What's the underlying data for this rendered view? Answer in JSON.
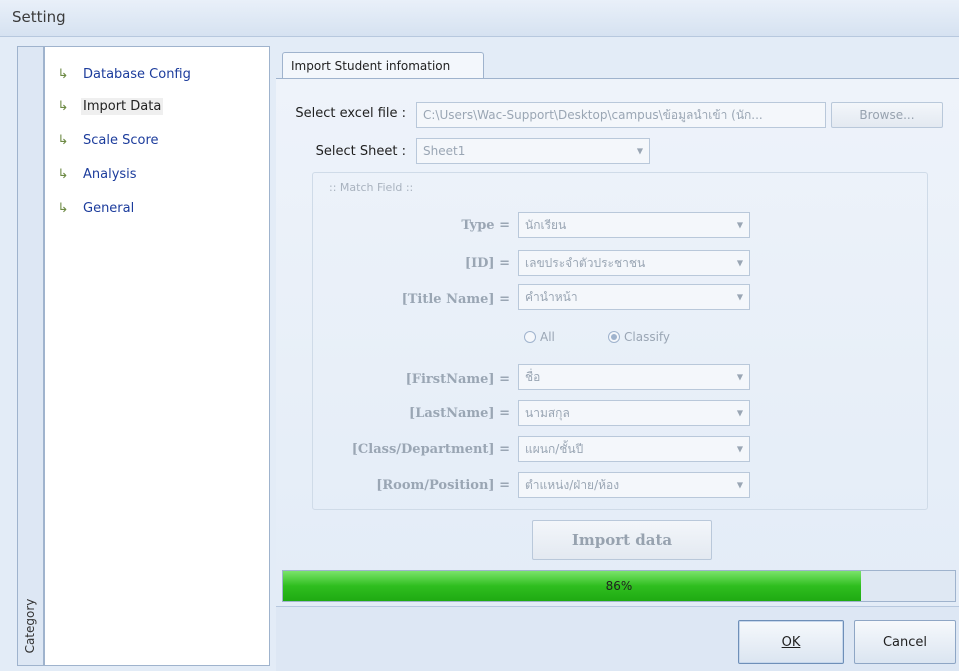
{
  "window": {
    "title": "Setting"
  },
  "category": {
    "label": "Category",
    "items": [
      {
        "label": "Database Config",
        "icon": "tree-arrow-icon",
        "active": false
      },
      {
        "label": "Import Data",
        "icon": "tree-arrow-icon",
        "active": true
      },
      {
        "label": "Scale Score",
        "icon": "tree-arrow-icon",
        "active": false
      },
      {
        "label": "Analysis",
        "icon": "tree-arrow-icon",
        "active": false
      },
      {
        "label": "General",
        "icon": "tree-arrow-icon",
        "active": false
      }
    ]
  },
  "tab": {
    "label": "Import Student infomation"
  },
  "excel": {
    "label": "Select excel file :",
    "value": "C:\\Users\\Wac-Support\\Desktop\\campus\\ข้อมูลนำเข้า (นัก...",
    "browse_label": "Browse..."
  },
  "sheet": {
    "label": "Select Sheet :",
    "value": "Sheet1"
  },
  "match": {
    "title": ":: Match Field ::",
    "type": {
      "label": "Type =",
      "value": "นักเรียน"
    },
    "id": {
      "label": "[ID] =",
      "value": "เลขประจำตัวประชาชน"
    },
    "title_name": {
      "label": "[Title Name] =",
      "value": "คำนำหน้า"
    },
    "radio_all": "All",
    "radio_classify": "Classify",
    "radio_selected": "Classify",
    "first_name": {
      "label": "[FirstName] =",
      "value": "ชื่อ"
    },
    "last_name": {
      "label": "[LastName] =",
      "value": "นามสกุล"
    },
    "class_dept": {
      "label": "[Class/Department] =",
      "value": "แผนก/ชั้นปี"
    },
    "room_pos": {
      "label": "[Room/Position] =",
      "value": "ตำแหน่ง/ฝ่าย/ห้อง"
    }
  },
  "import_button": "Import data",
  "progress": {
    "value": 86,
    "text": "86%"
  },
  "footer": {
    "ok_label": "OK",
    "cancel_label": "Cancel"
  },
  "colors": {
    "progress_fill": "#2fbe1f",
    "nav_link": "#1c3c9c",
    "disabled_text": "#9aa6b4"
  }
}
